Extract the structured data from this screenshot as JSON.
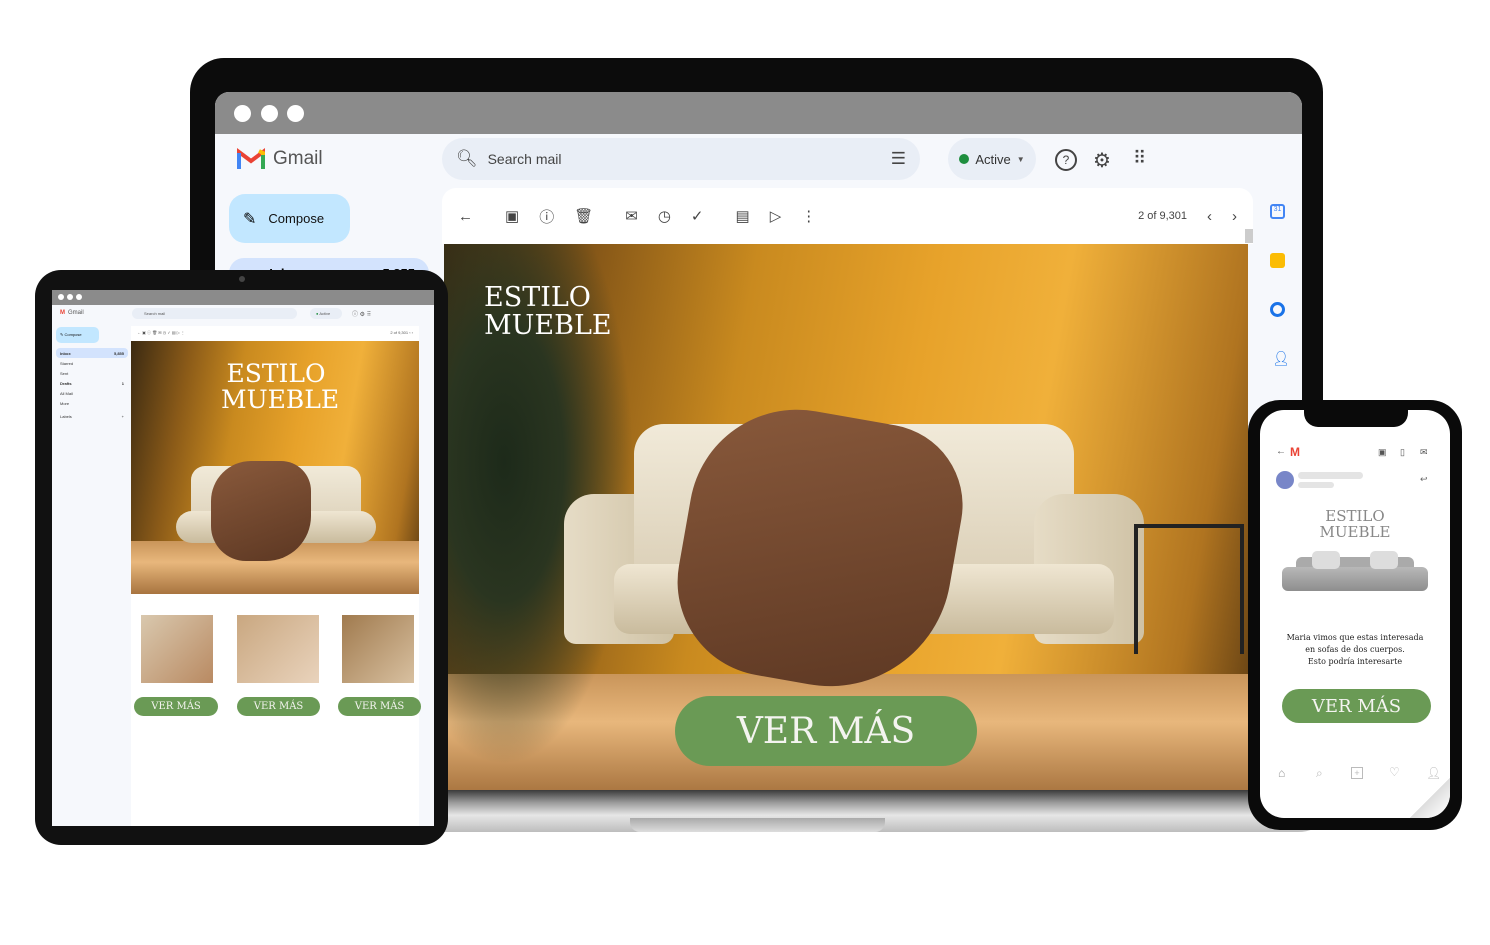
{
  "laptop": {
    "app_name": "Gmail",
    "compose_label": "Compose",
    "inbox_label": "Inbox",
    "inbox_count": "5,855",
    "search_placeholder": "Search mail",
    "status_label": "Active",
    "pagination": "2 of 9,301",
    "email": {
      "brand_line1": "ESTILO",
      "brand_line2": "MUEBLE",
      "cta_label": "VER MÁS"
    }
  },
  "tablet": {
    "app_name": "Gmail",
    "compose_label": "Compose",
    "search_placeholder": "Search mail",
    "status_label": "Active",
    "pagination": "2 of 9,301",
    "nav": [
      {
        "label": "Inbox",
        "count": "5,855"
      },
      {
        "label": "Starred",
        "count": ""
      },
      {
        "label": "Sent",
        "count": ""
      },
      {
        "label": "Drafts",
        "count": "1"
      },
      {
        "label": "All Mail",
        "count": ""
      },
      {
        "label": "More",
        "count": ""
      }
    ],
    "labels_heading": "Labels",
    "email": {
      "brand_line1": "ESTILO",
      "brand_line2": "MUEBLE",
      "product_buttons": [
        "VER MÁS",
        "VER MÁS",
        "VER MÁS"
      ]
    }
  },
  "phone": {
    "email": {
      "brand_line1": "ESTILO",
      "brand_line2": "MUEBLE",
      "message_line1": "Maria vimos que estas interesada",
      "message_line2": "en sofas de dos cuerpos.",
      "message_line3": "Esto podría interesarte",
      "cta_label": "VER MÁS"
    }
  },
  "colors": {
    "cta_green": "#6a9a55",
    "gmail_bg": "#f6f8fc",
    "compose_bg": "#c2e7ff",
    "active_green": "#1e8e3e",
    "wall_orange": "#e7a22a"
  }
}
